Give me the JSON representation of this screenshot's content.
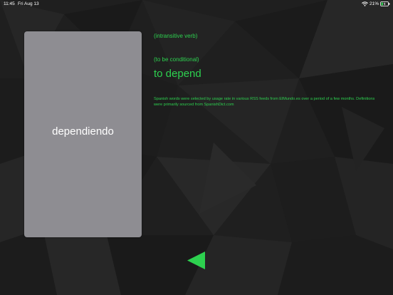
{
  "status_bar": {
    "time": "11:45",
    "date": "Fri Aug 13",
    "battery": "21%",
    "wifi_icon": "wifi-icon",
    "battery_icon": "battery-charging-icon"
  },
  "flashcard": {
    "word": "dependiendo"
  },
  "definition": {
    "part_of_speech_1": "(intransitive verb)",
    "part_of_speech_2": "(to be conditional)",
    "meaning": "to depend",
    "source_note": "Spanish words were selected by usage rate in various RSS feeds from ElMundo.es over a period of a few months. Definitions were primarily sourced from SpanishDict.com"
  },
  "navigation": {
    "back_icon": "triangle-left-icon"
  },
  "colors": {
    "accent": "#2dd14f",
    "card": "#8e8d92",
    "background": "#1f1f1f"
  }
}
